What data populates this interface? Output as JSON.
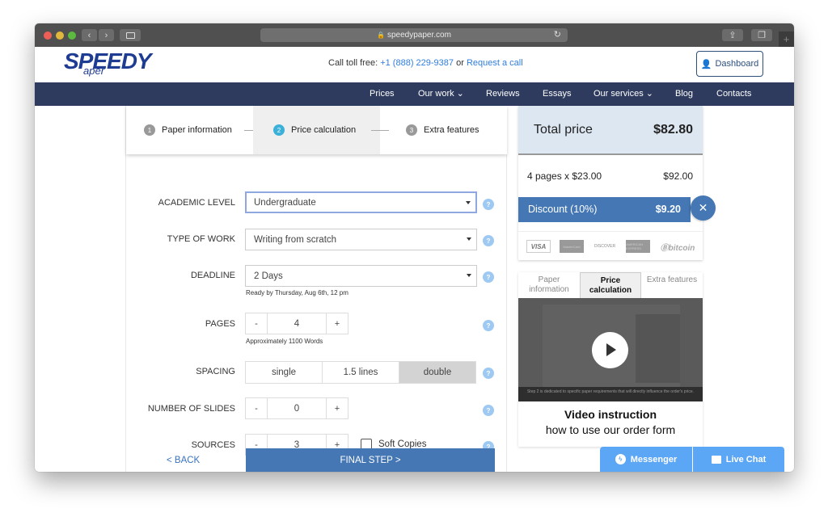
{
  "browser": {
    "url": "speedypaper.com",
    "lock_icon": "🔒",
    "reload_icon": "↻",
    "new_tab_icon": "+"
  },
  "header": {
    "logo_main": "SPEEDY",
    "logo_sub": "aper",
    "call_prefix": "Call toll free:",
    "phone": "+1 (888) 229-9387",
    "or_text": "or",
    "request_call": "Request a call",
    "dashboard_label": "Dashboard"
  },
  "nav": {
    "items": [
      {
        "label": "Prices"
      },
      {
        "label": "Our work ⌄"
      },
      {
        "label": "Reviews"
      },
      {
        "label": "Essays"
      },
      {
        "label": "Our services ⌄"
      },
      {
        "label": "Blog"
      },
      {
        "label": "Contacts"
      }
    ]
  },
  "steps": [
    {
      "num": "1",
      "label": "Paper information"
    },
    {
      "num": "2",
      "label": "Price calculation",
      "active": true
    },
    {
      "num": "3",
      "label": "Extra features"
    }
  ],
  "form": {
    "academic_level": {
      "label": "ACADEMIC LEVEL",
      "value": "Undergraduate"
    },
    "type_of_work": {
      "label": "TYPE OF WORK",
      "value": "Writing from scratch"
    },
    "deadline": {
      "label": "DEADLINE",
      "value": "2 Days",
      "hint": "Ready by Thursday, Aug 6th, 12 pm"
    },
    "pages": {
      "label": "PAGES",
      "value": "4",
      "hint": "Approximately 1100 Words"
    },
    "spacing": {
      "label": "SPACING",
      "options": [
        "single",
        "1.5 lines",
        "double"
      ],
      "selected": "double"
    },
    "slides": {
      "label": "NUMBER OF SLIDES",
      "value": "0"
    },
    "sources": {
      "label": "SOURCES",
      "value": "3"
    },
    "soft_copies": {
      "label": "Soft Copies",
      "checked": false
    },
    "minus": "-",
    "plus": "+",
    "help": "?",
    "back_label": "< BACK",
    "next_label": "FINAL STEP >"
  },
  "price": {
    "total_label": "Total price",
    "total_value": "$82.80",
    "line_label": "4 pages x $23.00",
    "line_value": "$92.00",
    "discount_label": "Discount (10%)",
    "discount_value": "$9.20",
    "close_icon": "✕",
    "payments": [
      "VISA",
      "MasterCard",
      "DISCOVER",
      "AMERICAN EXPRESS",
      "Ⓑbitcoin"
    ]
  },
  "video": {
    "tabs": [
      {
        "label": "Paper information"
      },
      {
        "label": "Price calculation",
        "active": true
      },
      {
        "label": "Extra features"
      }
    ],
    "caption": "Step 2 is dedicated to specific paper requirements that will directly influence the order's price.",
    "title": "Video instruction",
    "subtitle": "how to use our order form"
  },
  "chat": {
    "messenger": "Messenger",
    "live_chat": "Live Chat"
  },
  "colors": {
    "nav_bg": "#2e3b5e",
    "accent_blue": "#4477b3",
    "step_active": "#3bb0d8",
    "chat_blue": "#5ba6f5",
    "logo_blue": "#1f3c93"
  }
}
